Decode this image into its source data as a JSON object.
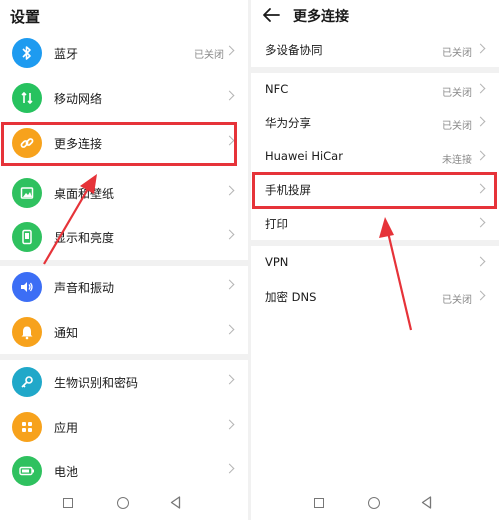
{
  "left": {
    "title": "设置",
    "items": [
      {
        "label": "蓝牙",
        "status": "已关闭",
        "icon": "bluetooth-icon",
        "color": "#1e9bf0"
      },
      {
        "label": "移动网络",
        "status": "",
        "icon": "mobile-data-icon",
        "color": "#27c25f"
      },
      {
        "label": "更多连接",
        "status": "",
        "icon": "link-icon",
        "color": "#f7a21c"
      },
      {
        "label": "桌面和壁纸",
        "status": "",
        "icon": "wallpaper-icon",
        "color": "#2fc15f"
      },
      {
        "label": "显示和亮度",
        "status": "",
        "icon": "display-icon",
        "color": "#2fc15f"
      },
      {
        "label": "声音和振动",
        "status": "",
        "icon": "sound-icon",
        "color": "#3c6ef5"
      },
      {
        "label": "通知",
        "status": "",
        "icon": "bell-icon",
        "color": "#f7a21c"
      },
      {
        "label": "生物识别和密码",
        "status": "",
        "icon": "key-icon",
        "color": "#20a8c9"
      },
      {
        "label": "应用",
        "status": "",
        "icon": "apps-icon",
        "color": "#f7a21c"
      },
      {
        "label": "电池",
        "status": "",
        "icon": "battery-icon",
        "color": "#2fc15f"
      }
    ]
  },
  "right": {
    "title": "更多连接",
    "items": [
      {
        "label": "多设备协同",
        "status": "已关闭"
      },
      {
        "label": "NFC",
        "status": "已关闭"
      },
      {
        "label": "华为分享",
        "status": "已关闭"
      },
      {
        "label": "Huawei HiCar",
        "status": "未连接"
      },
      {
        "label": "手机投屏",
        "status": ""
      },
      {
        "label": "打印",
        "status": ""
      },
      {
        "label": "VPN",
        "status": ""
      },
      {
        "label": "加密 DNS",
        "status": "已关闭"
      }
    ]
  },
  "colors": {
    "highlight": "#e63339",
    "band": "#f1f1f1"
  }
}
